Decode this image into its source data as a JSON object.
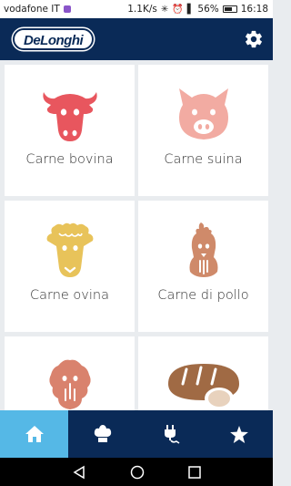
{
  "status_bar": {
    "carrier": "vodafone IT",
    "speed": "1.1K/s",
    "battery": "56%",
    "time": "16:18"
  },
  "app_bar": {
    "logo_text": "DeLonghi",
    "settings_icon": "gear-icon"
  },
  "categories": [
    {
      "label": "Carne bovina",
      "icon": "cow-icon",
      "color": "#e8565e"
    },
    {
      "label": "Carne suina",
      "icon": "pig-icon",
      "color": "#f2aba2"
    },
    {
      "label": "Carne ovina",
      "icon": "sheep-icon",
      "color": "#e8c35a"
    },
    {
      "label": "Carne di pollo",
      "icon": "chicken-icon",
      "color": "#cf8a6a"
    },
    {
      "label": "",
      "icon": "turkey-icon",
      "color": "#d9826d"
    },
    {
      "label": "",
      "icon": "bread-icon",
      "color": "#a06a44"
    }
  ],
  "bottom_nav": [
    {
      "icon": "home-icon",
      "active": true
    },
    {
      "icon": "chef-hat-icon",
      "active": false
    },
    {
      "icon": "plug-icon",
      "active": false
    },
    {
      "icon": "star-icon",
      "active": false
    }
  ],
  "colors": {
    "header": "#0a2a57",
    "active_nav": "#55b8e6",
    "tile_bg": "#ffffff",
    "page_bg": "#e9ecef"
  }
}
